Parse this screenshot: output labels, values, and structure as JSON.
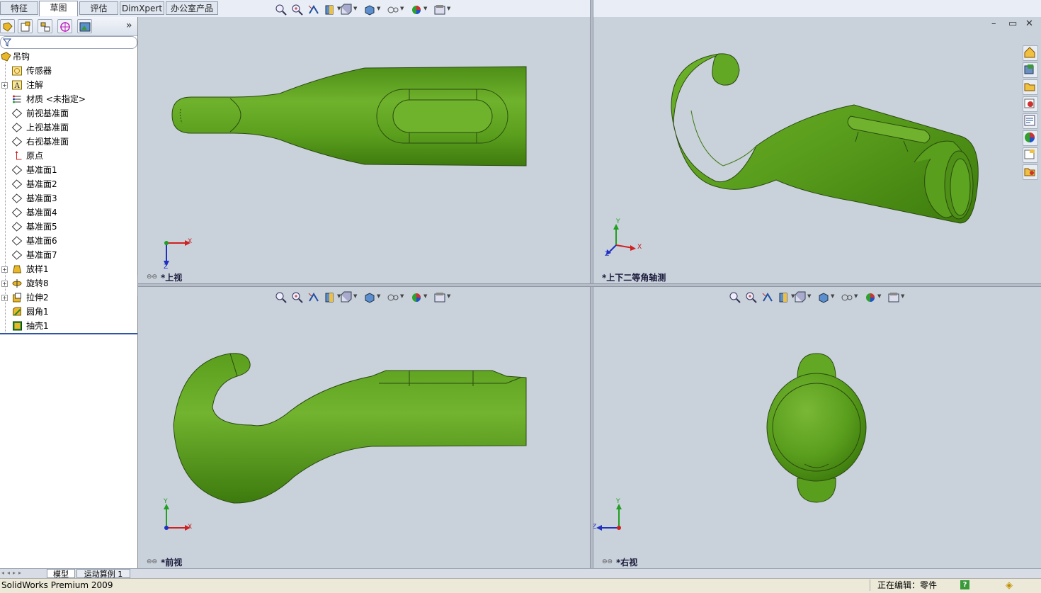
{
  "tabs": [
    "特征",
    "草图",
    "评估",
    "DimXpert",
    "办公室产品"
  ],
  "active_tab": "草图",
  "tree": {
    "root": "吊钩",
    "items": [
      {
        "label": "传感器",
        "icon": "sensor-icon",
        "expand": false
      },
      {
        "label": "注解",
        "icon": "annotation-icon",
        "expand": true
      },
      {
        "label": "材质 <未指定>",
        "icon": "material-icon",
        "expand": false
      },
      {
        "label": "前视基准面",
        "icon": "plane-icon",
        "expand": false
      },
      {
        "label": "上视基准面",
        "icon": "plane-icon",
        "expand": false
      },
      {
        "label": "右视基准面",
        "icon": "plane-icon",
        "expand": false
      },
      {
        "label": "原点",
        "icon": "origin-icon",
        "expand": false
      },
      {
        "label": "基准面1",
        "icon": "plane-icon",
        "expand": false
      },
      {
        "label": "基准面2",
        "icon": "plane-icon",
        "expand": false
      },
      {
        "label": "基准面3",
        "icon": "plane-icon",
        "expand": false
      },
      {
        "label": "基准面4",
        "icon": "plane-icon",
        "expand": false
      },
      {
        "label": "基准面5",
        "icon": "plane-icon",
        "expand": false
      },
      {
        "label": "基准面6",
        "icon": "plane-icon",
        "expand": false
      },
      {
        "label": "基准面7",
        "icon": "plane-icon",
        "expand": false
      },
      {
        "label": "放样1",
        "icon": "loft-icon",
        "expand": true
      },
      {
        "label": "旋转8",
        "icon": "revolve-icon",
        "expand": true
      },
      {
        "label": "拉伸2",
        "icon": "extrude-icon",
        "expand": true
      },
      {
        "label": "圆角1",
        "icon": "fillet-icon",
        "expand": false
      },
      {
        "label": "抽壳1",
        "icon": "shell-icon",
        "expand": false
      }
    ]
  },
  "viewports": {
    "top": "*上视",
    "iso": "*上下二等角轴测",
    "front": "*前视",
    "right": "*右视"
  },
  "axes": {
    "x": "X",
    "y": "Y",
    "z": "Z"
  },
  "bottom_tabs": [
    "模型",
    "运动算例 1"
  ],
  "status": {
    "app": "SolidWorks Premium 2009",
    "editing": "正在编辑：零件",
    "help": "?"
  },
  "colors": {
    "part_green": "#5ea21e",
    "part_dark": "#3e7a0e",
    "viewport_bg": "#c9d1db",
    "tree_selection": "#2f55a6"
  }
}
